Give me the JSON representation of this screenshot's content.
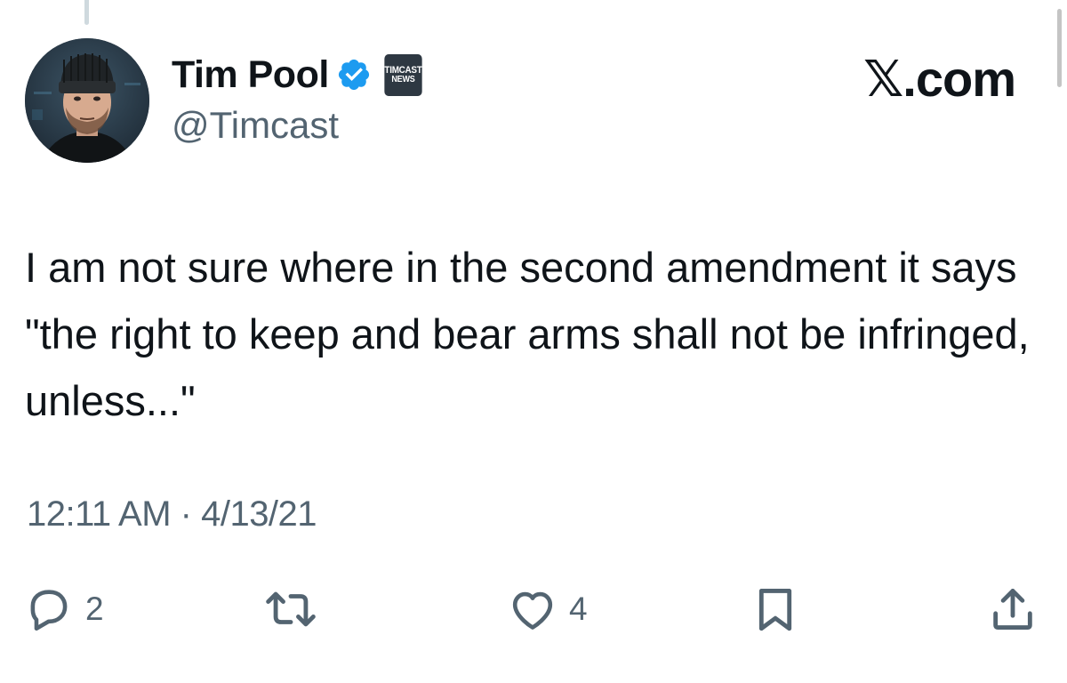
{
  "tweet": {
    "author": {
      "display_name": "Tim Pool",
      "handle": "@Timcast",
      "verified": true,
      "affiliate_badge": {
        "line1": "TIMCAST",
        "line2": "NEWS"
      }
    },
    "brand": "𝕏.com",
    "text": "I am not sure where in the second amendment it says \"the right to keep and bear arms shall not be infringed, unless...\"",
    "timestamp": "12:11 AM · 4/13/21",
    "actions": {
      "reply_count": "2",
      "retweet_count": "",
      "like_count": "4"
    }
  },
  "icons": {
    "reply": "reply-bubble-icon",
    "retweet": "retweet-icon",
    "like": "heart-icon",
    "bookmark": "bookmark-icon",
    "share": "share-icon",
    "verified": "verified-badge-icon"
  },
  "colors": {
    "text_primary": "#0f1419",
    "text_secondary": "#536471",
    "verified_blue": "#1d9bf0",
    "badge_dark": "#2e3842"
  }
}
